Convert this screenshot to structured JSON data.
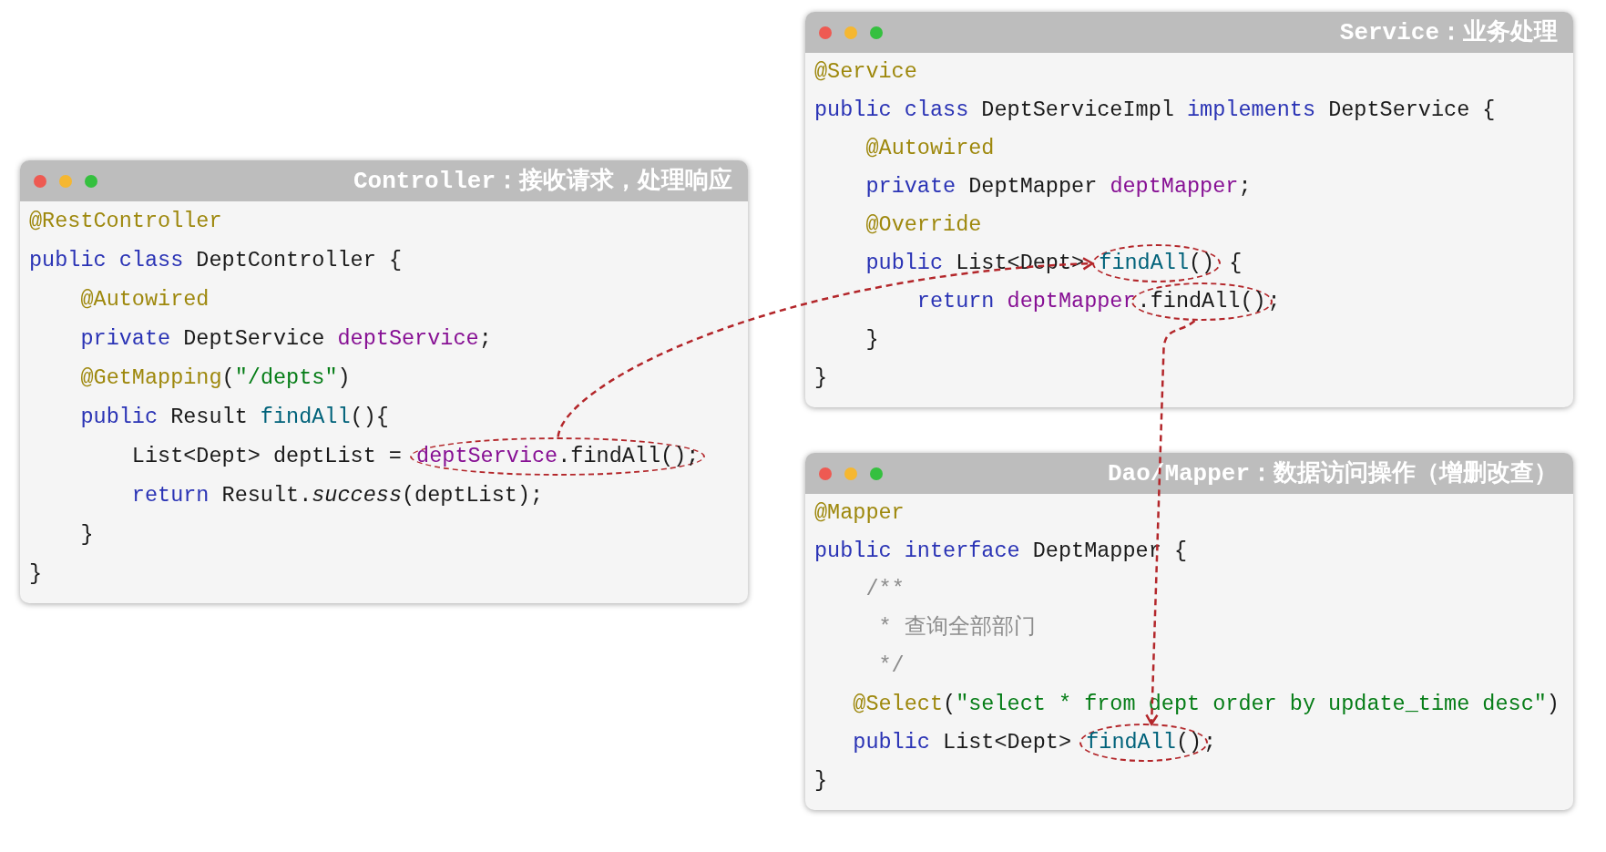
{
  "windows": [
    {
      "title": "Controller：接收请求，处理响应",
      "lines": [
        {
          "segments": [
            {
              "circled": false,
              "tokens": [
                {
                  "text": "@RestController",
                  "kind": "annotation"
                }
              ]
            }
          ]
        },
        {
          "segments": [
            {
              "circled": false,
              "tokens": [
                {
                  "text": "public class ",
                  "kind": "keyword"
                },
                {
                  "text": "DeptController {",
                  "kind": "plain"
                }
              ]
            }
          ]
        },
        {
          "segments": [
            {
              "circled": false,
              "tokens": [
                {
                  "text": "    @Autowired",
                  "kind": "annotation"
                }
              ]
            }
          ]
        },
        {
          "segments": [
            {
              "circled": false,
              "tokens": [
                {
                  "text": "    private ",
                  "kind": "keyword"
                },
                {
                  "text": "DeptService ",
                  "kind": "plain"
                },
                {
                  "text": "deptService",
                  "kind": "field"
                },
                {
                  "text": ";",
                  "kind": "plain"
                }
              ]
            }
          ]
        },
        {
          "segments": [
            {
              "circled": false,
              "tokens": [
                {
                  "text": "    @GetMapping",
                  "kind": "annotation"
                },
                {
                  "text": "(",
                  "kind": "plain"
                },
                {
                  "text": "\"/depts\"",
                  "kind": "string"
                },
                {
                  "text": ")",
                  "kind": "plain"
                }
              ]
            }
          ]
        },
        {
          "segments": [
            {
              "circled": false,
              "tokens": [
                {
                  "text": "    public ",
                  "kind": "keyword"
                },
                {
                  "text": "Result ",
                  "kind": "plain"
                },
                {
                  "text": "findAll",
                  "kind": "method"
                },
                {
                  "text": "(){",
                  "kind": "plain"
                }
              ]
            }
          ]
        },
        {
          "segments": [
            {
              "circled": false,
              "tokens": [
                {
                  "text": "        List<Dept> deptList = ",
                  "kind": "plain"
                }
              ]
            },
            {
              "circled": true,
              "tokens": [
                {
                  "text": "deptService",
                  "kind": "field"
                },
                {
                  "text": ".findAll();",
                  "kind": "plain"
                }
              ]
            }
          ]
        },
        {
          "segments": [
            {
              "circled": false,
              "tokens": [
                {
                  "text": "        return ",
                  "kind": "keyword"
                },
                {
                  "text": "Result.",
                  "kind": "plain"
                },
                {
                  "text": "success",
                  "kind": "static"
                },
                {
                  "text": "(deptList);",
                  "kind": "plain"
                }
              ]
            }
          ]
        },
        {
          "segments": [
            {
              "circled": false,
              "tokens": [
                {
                  "text": "    }",
                  "kind": "plain"
                }
              ]
            }
          ]
        },
        {
          "segments": [
            {
              "circled": false,
              "tokens": [
                {
                  "text": "}",
                  "kind": "plain"
                }
              ]
            }
          ]
        }
      ]
    },
    {
      "title": "Service：业务处理",
      "lines": [
        {
          "segments": [
            {
              "circled": false,
              "tokens": [
                {
                  "text": "@Service",
                  "kind": "annotation"
                }
              ]
            }
          ]
        },
        {
          "segments": [
            {
              "circled": false,
              "tokens": [
                {
                  "text": "public class ",
                  "kind": "keyword"
                },
                {
                  "text": "DeptServiceImpl ",
                  "kind": "plain"
                },
                {
                  "text": "implements ",
                  "kind": "keyword"
                },
                {
                  "text": "DeptService {",
                  "kind": "plain"
                }
              ]
            }
          ]
        },
        {
          "segments": [
            {
              "circled": false,
              "tokens": [
                {
                  "text": "    @Autowired",
                  "kind": "annotation"
                }
              ]
            }
          ]
        },
        {
          "segments": [
            {
              "circled": false,
              "tokens": [
                {
                  "text": "    private ",
                  "kind": "keyword"
                },
                {
                  "text": "DeptMapper ",
                  "kind": "plain"
                },
                {
                  "text": "deptMapper",
                  "kind": "field"
                },
                {
                  "text": ";",
                  "kind": "plain"
                }
              ]
            }
          ]
        },
        {
          "segments": [
            {
              "circled": false,
              "tokens": [
                {
                  "text": "    @Override",
                  "kind": "annotation"
                }
              ]
            }
          ]
        },
        {
          "segments": [
            {
              "circled": false,
              "tokens": [
                {
                  "text": "    public ",
                  "kind": "keyword"
                },
                {
                  "text": "List<Dept> ",
                  "kind": "plain"
                }
              ]
            },
            {
              "circled": true,
              "tokens": [
                {
                  "text": "findAll",
                  "kind": "method"
                },
                {
                  "text": "()",
                  "kind": "plain"
                }
              ]
            },
            {
              "circled": false,
              "tokens": [
                {
                  "text": " {",
                  "kind": "plain"
                }
              ]
            }
          ]
        },
        {
          "segments": [
            {
              "circled": false,
              "tokens": [
                {
                  "text": "        return ",
                  "kind": "keyword"
                },
                {
                  "text": "deptMapper",
                  "kind": "field"
                }
              ]
            },
            {
              "circled": true,
              "tokens": [
                {
                  "text": ".findAll()",
                  "kind": "plain"
                }
              ]
            },
            {
              "circled": false,
              "tokens": [
                {
                  "text": ";",
                  "kind": "plain"
                }
              ]
            }
          ]
        },
        {
          "segments": [
            {
              "circled": false,
              "tokens": [
                {
                  "text": "    }",
                  "kind": "plain"
                }
              ]
            }
          ]
        },
        {
          "segments": [
            {
              "circled": false,
              "tokens": [
                {
                  "text": "}",
                  "kind": "plain"
                }
              ]
            }
          ]
        }
      ]
    },
    {
      "title": "Dao/Mapper：数据访问操作（增删改查）",
      "lines": [
        {
          "segments": [
            {
              "circled": false,
              "tokens": [
                {
                  "text": "@Mapper",
                  "kind": "annotation"
                }
              ]
            }
          ]
        },
        {
          "segments": [
            {
              "circled": false,
              "tokens": [
                {
                  "text": "public interface ",
                  "kind": "keyword"
                },
                {
                  "text": "DeptMapper {",
                  "kind": "plain"
                }
              ]
            }
          ]
        },
        {
          "segments": [
            {
              "circled": false,
              "tokens": [
                {
                  "text": "    /**",
                  "kind": "comment"
                }
              ]
            }
          ]
        },
        {
          "segments": [
            {
              "circled": false,
              "tokens": [
                {
                  "text": "     * 查询全部部门",
                  "kind": "comment"
                }
              ]
            }
          ]
        },
        {
          "segments": [
            {
              "circled": false,
              "tokens": [
                {
                  "text": "     */",
                  "kind": "comment"
                }
              ]
            }
          ]
        },
        {
          "segments": [
            {
              "circled": false,
              "tokens": [
                {
                  "text": "   @Select",
                  "kind": "annotation"
                },
                {
                  "text": "(",
                  "kind": "plain"
                },
                {
                  "text": "\"select * from dept order by update_time desc\"",
                  "kind": "string"
                },
                {
                  "text": ")",
                  "kind": "plain"
                }
              ]
            }
          ]
        },
        {
          "segments": [
            {
              "circled": false,
              "tokens": [
                {
                  "text": "   public ",
                  "kind": "keyword"
                },
                {
                  "text": "List<Dept> ",
                  "kind": "plain"
                }
              ]
            },
            {
              "circled": true,
              "tokens": [
                {
                  "text": "findAll",
                  "kind": "method"
                },
                {
                  "text": "()",
                  "kind": "plain"
                }
              ]
            },
            {
              "circled": false,
              "tokens": [
                {
                  "text": ";",
                  "kind": "plain"
                }
              ]
            }
          ]
        },
        {
          "segments": [
            {
              "circled": false,
              "tokens": [
                {
                  "text": "}",
                  "kind": "plain"
                }
              ]
            }
          ]
        }
      ]
    }
  ]
}
